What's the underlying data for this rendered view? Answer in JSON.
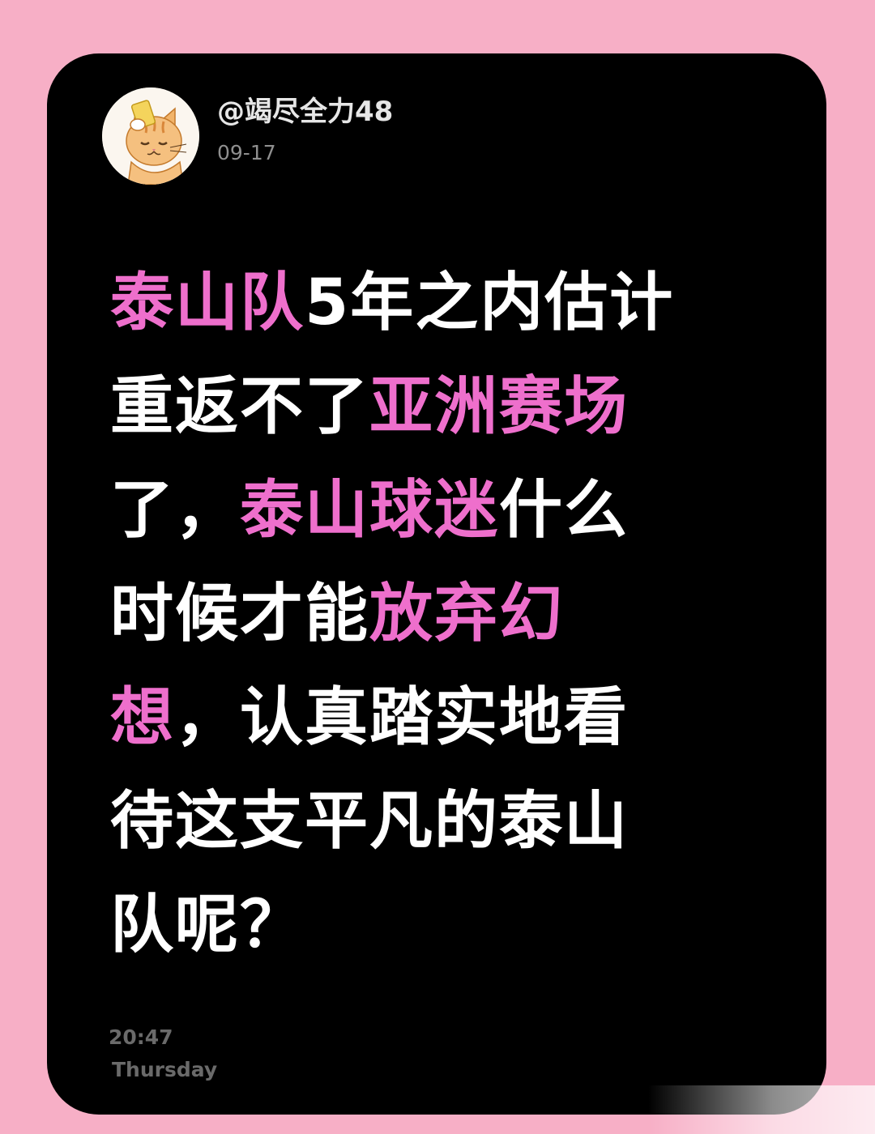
{
  "post": {
    "username": "@竭尽全力48",
    "date": "09-17",
    "segments": [
      [
        {
          "text": "泰山队",
          "hl": true
        },
        {
          "text": "5年之内估计",
          "hl": false
        }
      ],
      [
        {
          "text": "重返不了",
          "hl": false
        },
        {
          "text": "亚洲赛场",
          "hl": true
        }
      ],
      [
        {
          "text": "了，",
          "hl": false
        },
        {
          "text": "泰山球迷",
          "hl": true
        },
        {
          "text": "什么",
          "hl": false
        }
      ],
      [
        {
          "text": "时候才能",
          "hl": false
        },
        {
          "text": "放弃幻",
          "hl": true
        }
      ],
      [
        {
          "text": "想",
          "hl": true
        },
        {
          "text": "，认真踏实地看",
          "hl": false
        }
      ],
      [
        {
          "text": "待这支平凡的泰山",
          "hl": false
        }
      ],
      [
        {
          "text": "队呢？",
          "hl": false
        }
      ]
    ],
    "footer": {
      "time": "20:47",
      "weekday": "Thursday"
    }
  },
  "colors": {
    "page_background": "#f7afc6",
    "card_background": "#000000",
    "highlight": "#ee6fcc",
    "text": "#ffffff",
    "muted": "#8f8f8f"
  },
  "icons": {
    "avatar": "cartoon-cat-avatar"
  }
}
